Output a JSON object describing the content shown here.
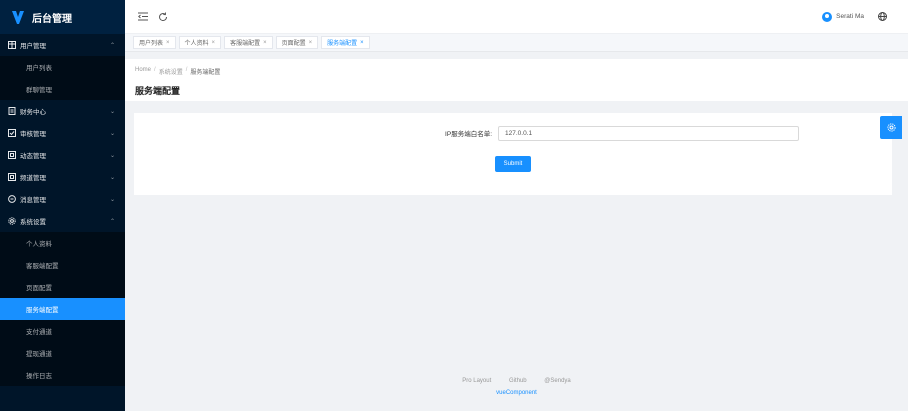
{
  "app": {
    "title": "后台管理",
    "brand_color": "#1890ff",
    "sidebar_bg": "#001529"
  },
  "sidebar": {
    "items": [
      {
        "label": "用户管理",
        "icon": "table-icon",
        "expanded": true,
        "children": [
          "用户列表",
          "群聊管理"
        ]
      },
      {
        "label": "财务中心",
        "icon": "file-icon",
        "expanded": false
      },
      {
        "label": "审核管理",
        "icon": "check-square-icon",
        "expanded": false
      },
      {
        "label": "动态管理",
        "icon": "grid-icon",
        "expanded": false
      },
      {
        "label": "频道管理",
        "icon": "grid-icon",
        "expanded": false
      },
      {
        "label": "消息管理",
        "icon": "message-icon",
        "expanded": false
      },
      {
        "label": "系统设置",
        "icon": "gear-icon",
        "expanded": true,
        "children": [
          "个人资料",
          "客服端配置",
          "页面配置",
          "服务端配置",
          "支付通道",
          "提现通道",
          "操作日志"
        ]
      }
    ],
    "active_child": "服务端配置"
  },
  "header": {
    "user_name": "Serati Ma"
  },
  "tabs": [
    {
      "label": "用户列表",
      "active": false
    },
    {
      "label": "个人资料",
      "active": false
    },
    {
      "label": "客服端配置",
      "active": false
    },
    {
      "label": "页面配置",
      "active": false
    },
    {
      "label": "服务端配置",
      "active": true
    }
  ],
  "breadcrumb": [
    "Home",
    "系统设置",
    "服务端配置"
  ],
  "page_title": "服务端配置",
  "form": {
    "label": "IP服务端白名单:",
    "value": "127.0.0.1",
    "submit_label": "Submit"
  },
  "footer": {
    "links": [
      "Pro Layout",
      "Github",
      "@Sendya"
    ],
    "sub": "vueComponent"
  }
}
